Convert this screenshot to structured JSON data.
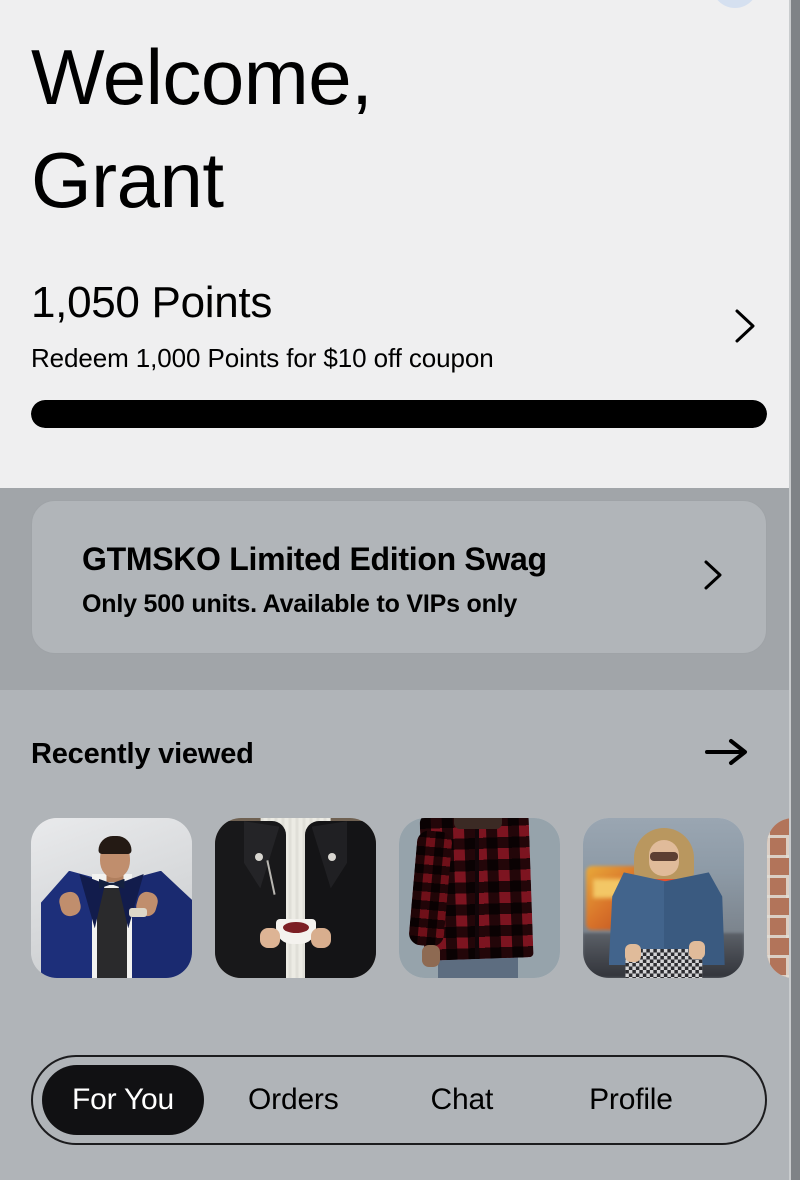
{
  "header": {
    "greeting": "Welcome,\nGrant",
    "status_blob": "notification-blob"
  },
  "rewards": {
    "points_value": "1,050 Points",
    "points_subtitle": "Redeem 1,000 Points for $10 off coupon",
    "chevron": "chevron-right-icon",
    "progress_percent": 100
  },
  "promo": {
    "title": "GTMSKO Limited Edition Swag",
    "subtitle": "Only 500 units. Available to VIPs only",
    "chevron": "chevron-right-icon"
  },
  "recently_viewed": {
    "title": "Recently viewed",
    "see_all_icon": "arrow-right-icon",
    "items": [
      {
        "alt": "Man in blue patterned tuxedo jacket adjusting bow tie"
      },
      {
        "alt": "Person in black leather biker jacket over white knit sweater holding a cup"
      },
      {
        "alt": "Red and black buffalo plaid flannel shirt"
      },
      {
        "alt": "Woman in denim jacket and orange crop top at a carnival"
      },
      {
        "alt": "Brick wall with dark item"
      }
    ]
  },
  "bottom_nav": {
    "items": [
      {
        "label": "For You",
        "active": true
      },
      {
        "label": "Orders",
        "active": false
      },
      {
        "label": "Chat",
        "active": false
      },
      {
        "label": "Profile",
        "active": false
      }
    ]
  },
  "colors": {
    "header_bg": "#efeff0",
    "promo_band_bg": "#a1a5a9",
    "promo_card_bg": "#b1b5b9",
    "recent_bg": "#b0b4b8",
    "accent_black": "#000000",
    "nav_active_bg": "#111113",
    "status_blob": "#d5e0f0"
  }
}
